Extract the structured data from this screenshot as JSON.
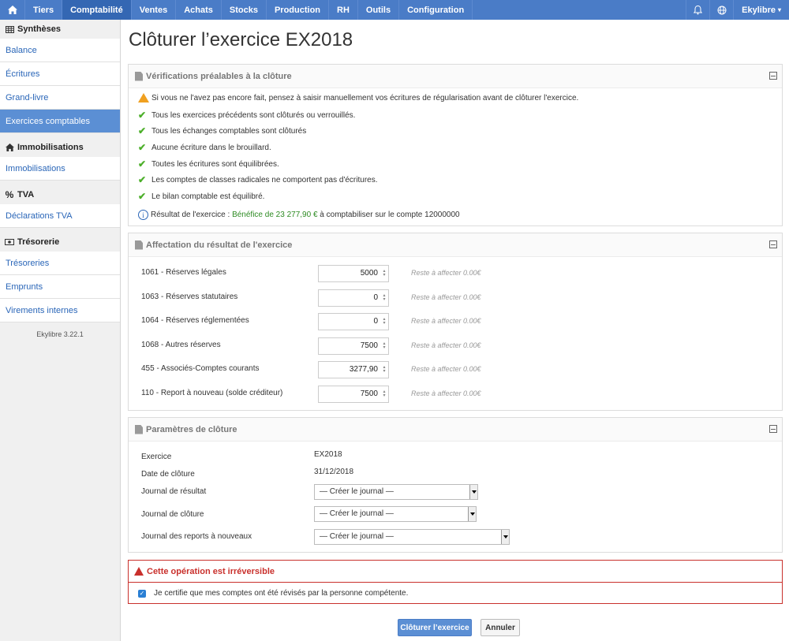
{
  "topnav": {
    "items": [
      "Tiers",
      "Comptabilité",
      "Ventes",
      "Achats",
      "Stocks",
      "Production",
      "RH",
      "Outils",
      "Configuration"
    ],
    "active": "Comptabilité",
    "user": "Ekylibre"
  },
  "sidebar": {
    "sections": [
      {
        "title": "Synthèses",
        "icon": "table-icon",
        "items": [
          "Balance",
          "Écritures",
          "Grand-livre",
          "Exercices comptables"
        ]
      },
      {
        "title": "Immobilisations",
        "icon": "home-icon",
        "items": [
          "Immobilisations"
        ]
      },
      {
        "title": "TVA",
        "icon": "percent-icon",
        "items": [
          "Déclarations TVA"
        ]
      },
      {
        "title": "Trésorerie",
        "icon": "money-icon",
        "items": [
          "Trésoreries",
          "Emprunts",
          "Virements internes"
        ]
      }
    ],
    "active_item": "Exercices comptables",
    "version": "Ekylibre 3.22.1"
  },
  "page": {
    "title": "Clôturer l’exercice EX2018"
  },
  "checks": {
    "title": "Vérifications préalables à la clôture",
    "warning": "Si vous ne l'avez pas encore fait, pensez à saisir manuellement vos écritures de régularisation avant de clôturer l'exercice.",
    "items": [
      "Tous les exercices précédents sont clôturés ou verrouillés.",
      "Tous les échanges comptables sont clôturés",
      "Aucune écriture dans le brouillard.",
      "Toutes les écritures sont équilibrées.",
      "Les comptes de classes radicales ne comportent pas d'écritures.",
      "Le bilan comptable est équilibré."
    ],
    "result_label": "Résultat de l'exercice : ",
    "result_value": "Bénéfice de 23 277,90 €",
    "result_suffix": " à comptabiliser sur le compte 12000000"
  },
  "allocation": {
    "title": "Affectation du résultat de l'exercice",
    "rows": [
      {
        "label": "1061 - Réserves légales",
        "value": "5000",
        "rest": "Reste à affecter 0.00€"
      },
      {
        "label": "1063 - Réserves statutaires",
        "value": "0",
        "rest": "Reste à affecter 0.00€"
      },
      {
        "label": "1064 - Réserves réglementées",
        "value": "0",
        "rest": "Reste à affecter 0.00€"
      },
      {
        "label": "1068 - Autres réserves",
        "value": "7500",
        "rest": "Reste à affecter 0.00€"
      },
      {
        "label": "455 - Associés-Comptes courants",
        "value": "3277,90",
        "rest": "Reste à affecter 0.00€"
      },
      {
        "label": "110 - Report à nouveau (solde créditeur)",
        "value": "7500",
        "rest": "Reste à affecter 0.00€"
      }
    ]
  },
  "params": {
    "title": "Paramètres de clôture",
    "exercice_label": "Exercice",
    "exercice_value": "EX2018",
    "date_label": "Date de clôture",
    "date_value": "31/12/2018",
    "journal_result_label": "Journal de résultat",
    "journal_result_value": "— Créer le journal —",
    "journal_close_label": "Journal de clôture",
    "journal_close_value": "— Créer le journal —",
    "journal_reports_label": "Journal des reports à nouveaux",
    "journal_reports_value": "— Créer le journal —"
  },
  "warning_box": {
    "title": "Cette opération est irréversible",
    "certify": "Je certifie que mes comptes ont été révisés par la personne compétente."
  },
  "buttons": {
    "close": "Clôturer l’exercice",
    "cancel": "Annuler"
  },
  "colors": {
    "nav": "#4a7cc7",
    "accent": "#5b8fd4",
    "danger": "#c9302c",
    "success": "#4caf2a"
  }
}
